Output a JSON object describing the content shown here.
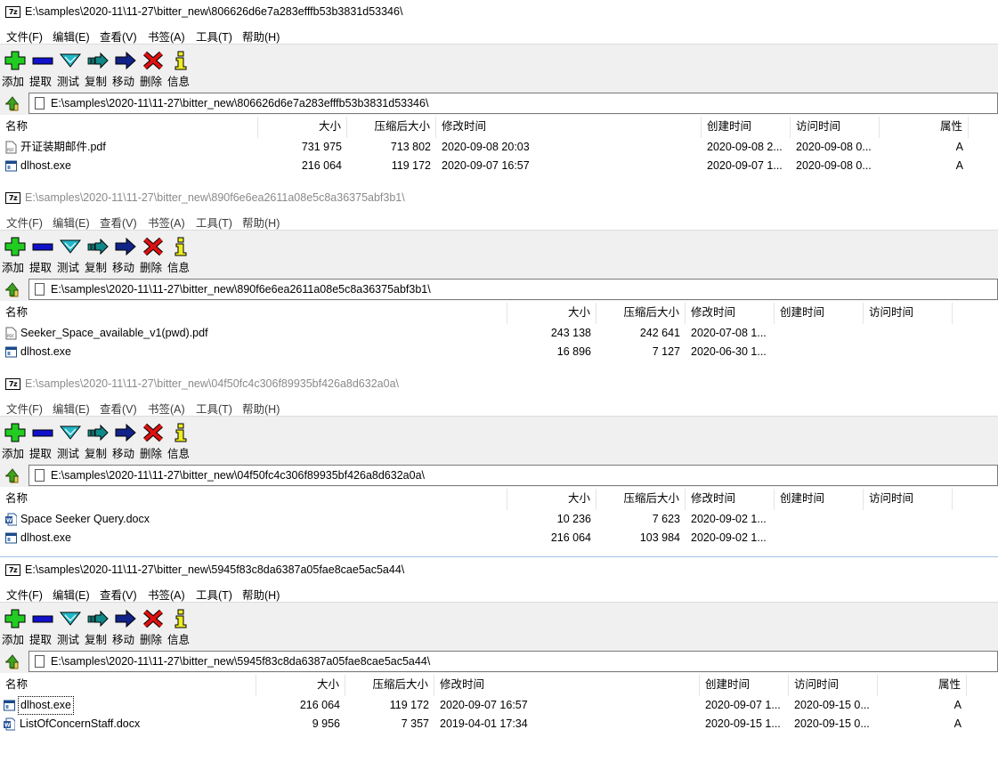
{
  "menu": [
    "文件(F)",
    "编辑(E)",
    "查看(V)",
    "书签(A)",
    "工具(T)",
    "帮助(H)"
  ],
  "toolbar": [
    {
      "label": "添加",
      "icon": "add-icon"
    },
    {
      "label": "提取",
      "icon": "extract-icon"
    },
    {
      "label": "测试",
      "icon": "test-icon"
    },
    {
      "label": "复制",
      "icon": "copy-icon"
    },
    {
      "label": "移动",
      "icon": "move-icon"
    },
    {
      "label": "删除",
      "icon": "delete-icon"
    },
    {
      "label": "信息",
      "icon": "info-icon"
    }
  ],
  "colors": {
    "add": "#22cc22",
    "extract": "#1111cc",
    "test": "#22b8c8",
    "copy": "#118888",
    "move": "#112288",
    "delete": "#dd1111",
    "info": "#eeee22"
  },
  "windows": [
    {
      "title": "E:\\samples\\2020-11\\11-27\\bitter_new\\806626d6e7a283efffb53b3831d53346\\",
      "address": "E:\\samples\\2020-11\\11-27\\bitter_new\\806626d6e7a283efffb53b3831d53346\\",
      "columns": [
        "名称",
        "大小",
        "压缩后大小",
        "修改时间",
        "创建时间",
        "访问时间",
        "属性"
      ],
      "rows": [
        {
          "icon": "pdf-file-icon",
          "name": "开证装期邮件.pdf",
          "size": "731 975",
          "packed": "713 802",
          "modified": "2020-09-08 20:03",
          "created": "2020-09-08 2...",
          "accessed": "2020-09-08 0...",
          "attr": "A"
        },
        {
          "icon": "exe-file-icon",
          "name": "dlhost.exe",
          "size": "216 064",
          "packed": "119 172",
          "modified": "2020-09-07 16:57",
          "created": "2020-09-07 1...",
          "accessed": "2020-09-08 0...",
          "attr": "A"
        }
      ]
    },
    {
      "title": "E:\\samples\\2020-11\\11-27\\bitter_new\\890f6e6ea2611a08e5c8a36375abf3b1\\",
      "address": "E:\\samples\\2020-11\\11-27\\bitter_new\\890f6e6ea2611a08e5c8a36375abf3b1\\",
      "columns": [
        "名称",
        "大小",
        "压缩后大小",
        "修改时间",
        "创建时间",
        "访问时间"
      ],
      "rows": [
        {
          "icon": "pdf-file-icon",
          "name": "Seeker_Space_available_v1(pwd).pdf",
          "size": "243 138",
          "packed": "242 641",
          "modified": "2020-07-08 1..."
        },
        {
          "icon": "exe-file-icon",
          "name": "dlhost.exe",
          "size": "16 896",
          "packed": "7 127",
          "modified": "2020-06-30 1..."
        }
      ]
    },
    {
      "title": "E:\\samples\\2020-11\\11-27\\bitter_new\\04f50fc4c306f89935bf426a8d632a0a\\",
      "address": "E:\\samples\\2020-11\\11-27\\bitter_new\\04f50fc4c306f89935bf426a8d632a0a\\",
      "columns": [
        "名称",
        "大小",
        "压缩后大小",
        "修改时间",
        "创建时间",
        "访问时间"
      ],
      "rows": [
        {
          "icon": "docx-file-icon",
          "name": "Space Seeker Query.docx",
          "size": "10 236",
          "packed": "7 623",
          "modified": "2020-09-02 1..."
        },
        {
          "icon": "exe-file-icon",
          "name": "dlhost.exe",
          "size": "216 064",
          "packed": "103 984",
          "modified": "2020-09-02 1..."
        }
      ]
    },
    {
      "title": "E:\\samples\\2020-11\\11-27\\bitter_new\\5945f83c8da6387a05fae8cae5ac5a44\\",
      "address": "E:\\samples\\2020-11\\11-27\\bitter_new\\5945f83c8da6387a05fae8cae5ac5a44\\",
      "columns": [
        "名称",
        "大小",
        "压缩后大小",
        "修改时间",
        "创建时间",
        "访问时间",
        "属性"
      ],
      "rows": [
        {
          "icon": "exe-file-icon",
          "name": "dlhost.exe",
          "size": "216 064",
          "packed": "119 172",
          "modified": "2020-09-07 16:57",
          "created": "2020-09-07 1...",
          "accessed": "2020-09-15 0...",
          "attr": "A"
        },
        {
          "icon": "docx-file-icon",
          "name": "ListOfConcernStaff.docx",
          "size": "9 956",
          "packed": "7 357",
          "modified": "2019-04-01 17:34",
          "created": "2020-09-15 1...",
          "accessed": "2020-09-15 0...",
          "attr": "A"
        }
      ]
    }
  ]
}
